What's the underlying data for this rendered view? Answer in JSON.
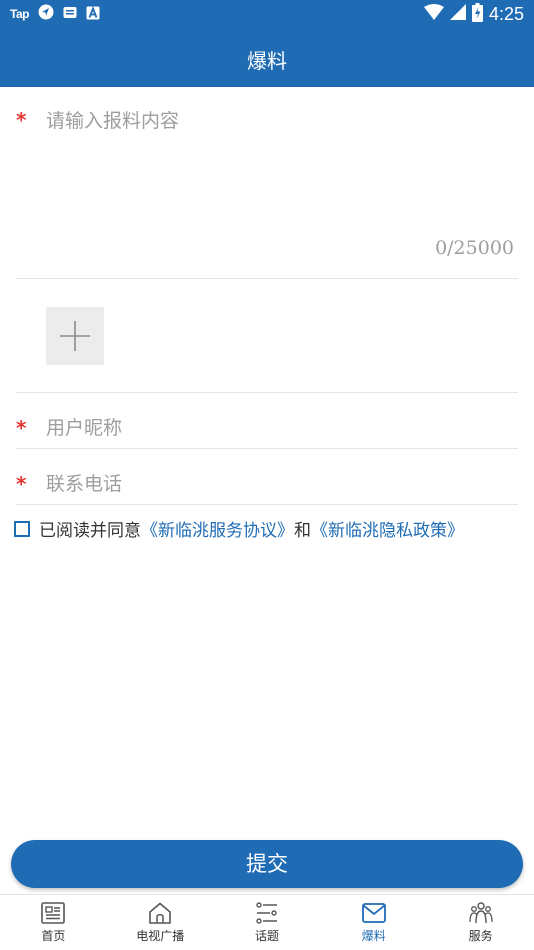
{
  "status_bar": {
    "left_icons": [
      "tap-icon",
      "navigation-icon",
      "message-icon",
      "a-box-icon"
    ],
    "tap_text": "Tap",
    "time": "4:25",
    "right_icons": [
      "wifi-icon",
      "signal-icon",
      "battery-icon"
    ]
  },
  "header": {
    "title": "爆料"
  },
  "form": {
    "content": {
      "placeholder": "请输入报料内容",
      "value": "",
      "counter": "0/25000"
    },
    "nickname": {
      "placeholder": "用户昵称",
      "value": ""
    },
    "phone": {
      "placeholder": "联系电话",
      "value": ""
    },
    "add_media_icon": "plus-icon",
    "agreement": {
      "checked": false,
      "prefix": "已阅读并同意",
      "service_link": "《新临洮服务协议》",
      "conjunction": "和",
      "privacy_link": "《新临洮隐私政策》"
    }
  },
  "submit": {
    "label": "提交"
  },
  "tab_bar": {
    "items": [
      {
        "label": "首页",
        "icon": "news-icon",
        "active": false
      },
      {
        "label": "电视广播",
        "icon": "home-icon",
        "active": false
      },
      {
        "label": "话题",
        "icon": "topic-list-icon",
        "active": false
      },
      {
        "label": "爆料",
        "icon": "mail-icon",
        "active": true
      },
      {
        "label": "服务",
        "icon": "people-icon",
        "active": false
      }
    ]
  },
  "colors": {
    "primary": "#1f6cb5",
    "required": "#e53935",
    "placeholder": "#9e9e9e"
  }
}
